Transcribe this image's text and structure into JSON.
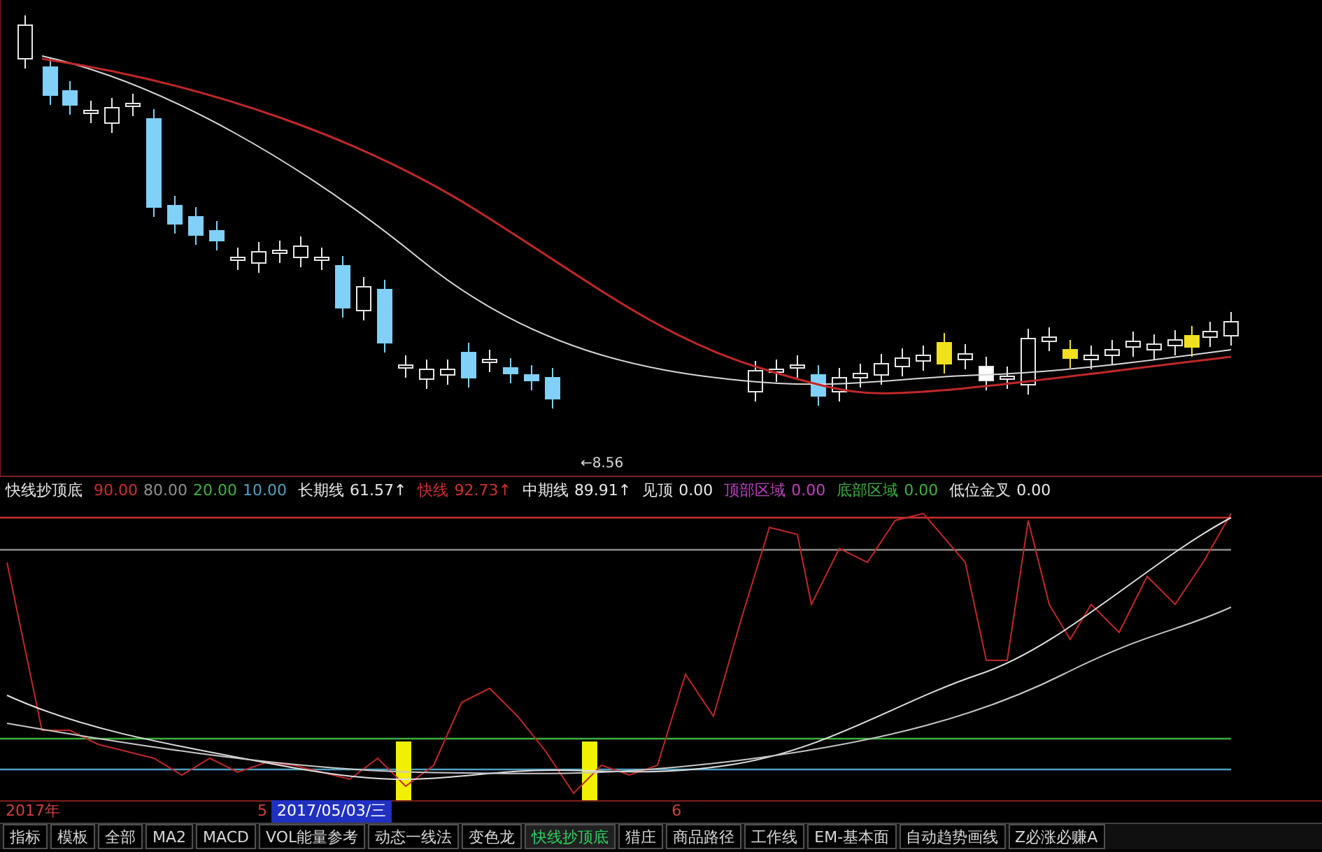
{
  "price_marker": "←8.56",
  "indicator": {
    "name": "快线抄顶底",
    "levels": [
      {
        "value": "90.00",
        "color": "#c83030"
      },
      {
        "value": "80.00",
        "color": "#909090"
      },
      {
        "value": "20.00",
        "color": "#40b040"
      },
      {
        "value": "10.00",
        "color": "#50a0c0"
      }
    ],
    "readings": [
      {
        "label": "长期线",
        "value": "61.57↑",
        "color": "#e8e8e8"
      },
      {
        "label": "快线",
        "value": "92.73↑",
        "color": "#d03030"
      },
      {
        "label": "中期线",
        "value": "89.91↑",
        "color": "#e8e8e8"
      },
      {
        "label": "见顶",
        "value": "0.00",
        "color": "#e8e8e8"
      },
      {
        "label": "顶部区域",
        "value": "0.00",
        "color": "#c040c0"
      },
      {
        "label": "底部区域",
        "value": "0.00",
        "color": "#40b040"
      },
      {
        "label": "低位金叉",
        "value": "0.00",
        "color": "#e8e8e8"
      }
    ]
  },
  "date_axis": [
    {
      "text": "2017年",
      "selected": false
    },
    {
      "text": "5",
      "selected": false
    },
    {
      "text": "2017/05/03/三",
      "selected": true
    },
    {
      "text": "6",
      "selected": false
    }
  ],
  "tabs": [
    {
      "label": "指标",
      "selected": false
    },
    {
      "label": "模板",
      "selected": false
    },
    {
      "label": "全部",
      "selected": false
    },
    {
      "label": "MA2",
      "selected": false
    },
    {
      "label": "MACD",
      "selected": false
    },
    {
      "label": "VOL能量参考",
      "selected": false
    },
    {
      "label": "动态一线法",
      "selected": false
    },
    {
      "label": "变色龙",
      "selected": false
    },
    {
      "label": "快线抄顶底",
      "selected": true
    },
    {
      "label": "猎庄",
      "selected": false
    },
    {
      "label": "商品路径",
      "selected": false
    },
    {
      "label": "工作线",
      "selected": false
    },
    {
      "label": "EM-基本面",
      "selected": false
    },
    {
      "label": "自动趋势画线",
      "selected": false
    },
    {
      "label": "Z必涨必赚A",
      "selected": false
    }
  ]
}
